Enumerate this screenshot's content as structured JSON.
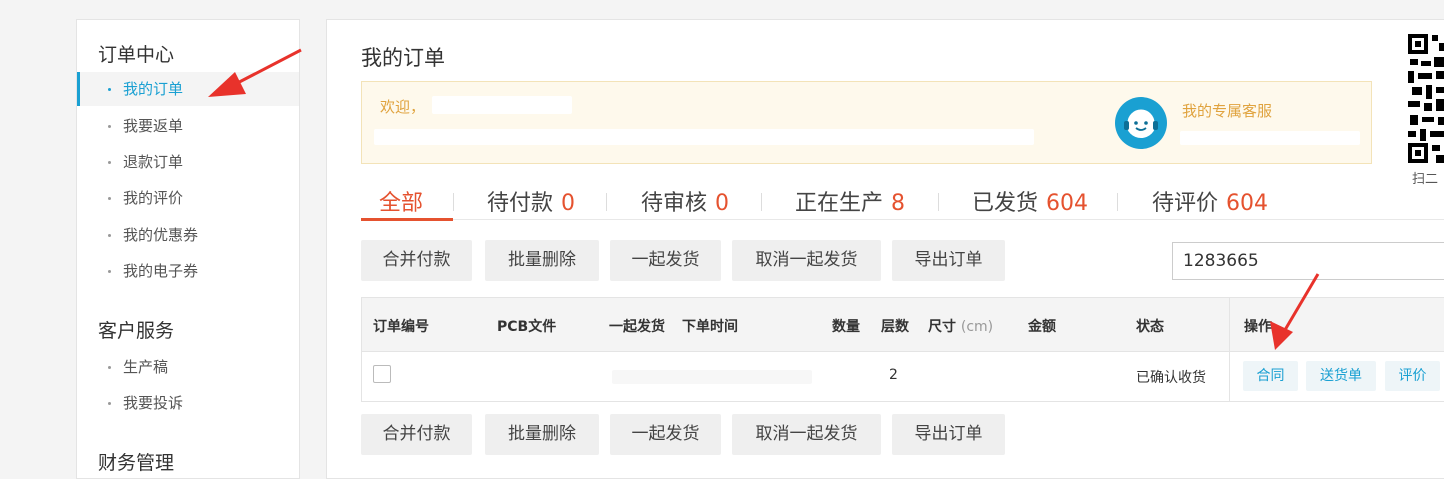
{
  "sidebar": {
    "sections": [
      {
        "title": "订单中心",
        "items": [
          {
            "label": "我的订单",
            "active": true
          },
          {
            "label": "我要返单"
          },
          {
            "label": "退款订单"
          },
          {
            "label": "我的评价"
          },
          {
            "label": "我的优惠券"
          },
          {
            "label": "我的电子券"
          }
        ]
      },
      {
        "title": "客户服务",
        "items": [
          {
            "label": "生产稿"
          },
          {
            "label": "我要投诉"
          }
        ]
      },
      {
        "title": "财务管理",
        "items": []
      }
    ]
  },
  "main": {
    "title": "我的订单",
    "welcome": {
      "greeting": "欢迎，",
      "service_label": "我的专属客服"
    },
    "tabs": [
      {
        "label": "全部",
        "count": "",
        "active": true
      },
      {
        "label": "待付款",
        "count": "0"
      },
      {
        "label": "待审核",
        "count": "0"
      },
      {
        "label": "正在生产",
        "count": "8"
      },
      {
        "label": "已发货",
        "count": "604"
      },
      {
        "label": "待评价",
        "count": "604"
      }
    ],
    "actions": [
      "合并付款",
      "批量删除",
      "一起发货",
      "取消一起发货",
      "导出订单"
    ],
    "search": {
      "value": "1283665"
    },
    "table": {
      "headers": {
        "order_no": "订单编号",
        "pcb_file": "PCB文件",
        "ship_together": "一起发货",
        "order_time": "下单时间",
        "quantity": "数量",
        "layers": "层数",
        "size": "尺寸",
        "size_unit": "(cm)",
        "amount": "金额",
        "status": "状态",
        "operation": "操作"
      },
      "rows": [
        {
          "layers": "2",
          "status": "已确认收货",
          "ops": [
            "合同",
            "送货单",
            "评价"
          ]
        }
      ]
    }
  },
  "qr": {
    "caption": "扫二"
  },
  "colors": {
    "accent": "#1aa0d2",
    "tab_active": "#e5522f",
    "welcome_text": "#e0a33e"
  }
}
